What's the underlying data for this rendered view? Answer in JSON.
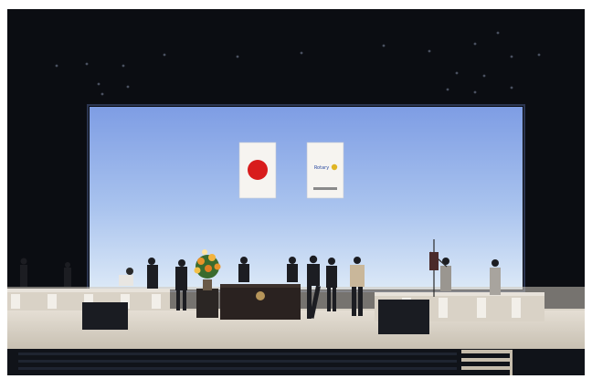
{
  "photo": {
    "description_hidden": "",
    "banner_right": {
      "logo_text": "Rotary",
      "caption_text": ""
    },
    "flag": "japan-flag",
    "colors": {
      "screen_top": "#8aa8e8",
      "screen_bottom": "#d4e4f6",
      "hall_dark": "#0b0d12",
      "stage_floor": "#d8d2c8",
      "flag_red": "#d81c1c",
      "flowers": "#e8932a"
    }
  }
}
